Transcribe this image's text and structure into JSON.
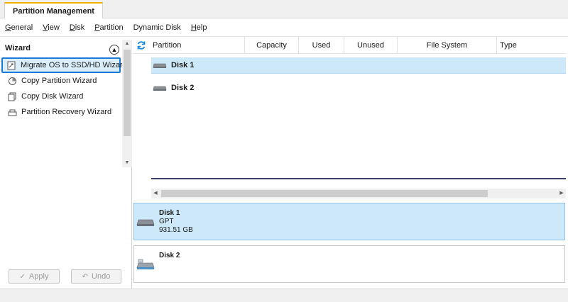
{
  "window": {
    "tab_title": "Partition Management"
  },
  "menu": [
    {
      "label": "General",
      "u": "G",
      "rest": "eneral"
    },
    {
      "label": "View",
      "u": "V",
      "rest": "iew"
    },
    {
      "label": "Disk",
      "u": "D",
      "rest": "isk"
    },
    {
      "label": "Partition",
      "u": "P",
      "rest": "artition"
    },
    {
      "label": "Dynamic Disk",
      "u": "",
      "rest": "Dynamic Disk"
    },
    {
      "label": "Help",
      "u": "H",
      "rest": "elp"
    }
  ],
  "sidebar": {
    "title": "Wizard",
    "items": [
      {
        "label": "Migrate OS to SSD/HD Wizard",
        "icon": "migrate-os-icon",
        "selected": true
      },
      {
        "label": "Copy Partition Wizard",
        "icon": "copy-partition-icon",
        "selected": false
      },
      {
        "label": "Copy Disk Wizard",
        "icon": "copy-disk-icon",
        "selected": false
      },
      {
        "label": "Partition Recovery Wizard",
        "icon": "partition-recovery-icon",
        "selected": false
      }
    ],
    "apply_label": "Apply",
    "undo_label": "Undo"
  },
  "table": {
    "columns": [
      "Partition",
      "Capacity",
      "Used",
      "Unused",
      "File System",
      "Type"
    ],
    "rows": [
      {
        "label": "Disk 1",
        "selected": true
      },
      {
        "label": "Disk 2",
        "selected": false
      }
    ]
  },
  "disk_map": [
    {
      "name": "Disk 1",
      "style": "GPT",
      "size": "931.51 GB",
      "selected": true
    },
    {
      "name": "Disk 2",
      "style": "",
      "size": "",
      "selected": false
    }
  ],
  "colors": {
    "selection_bg": "#cde8f8",
    "selection_border": "#1c7ad8",
    "tab_accent": "#f0b400",
    "refresh_icon": "#1e88d8"
  }
}
